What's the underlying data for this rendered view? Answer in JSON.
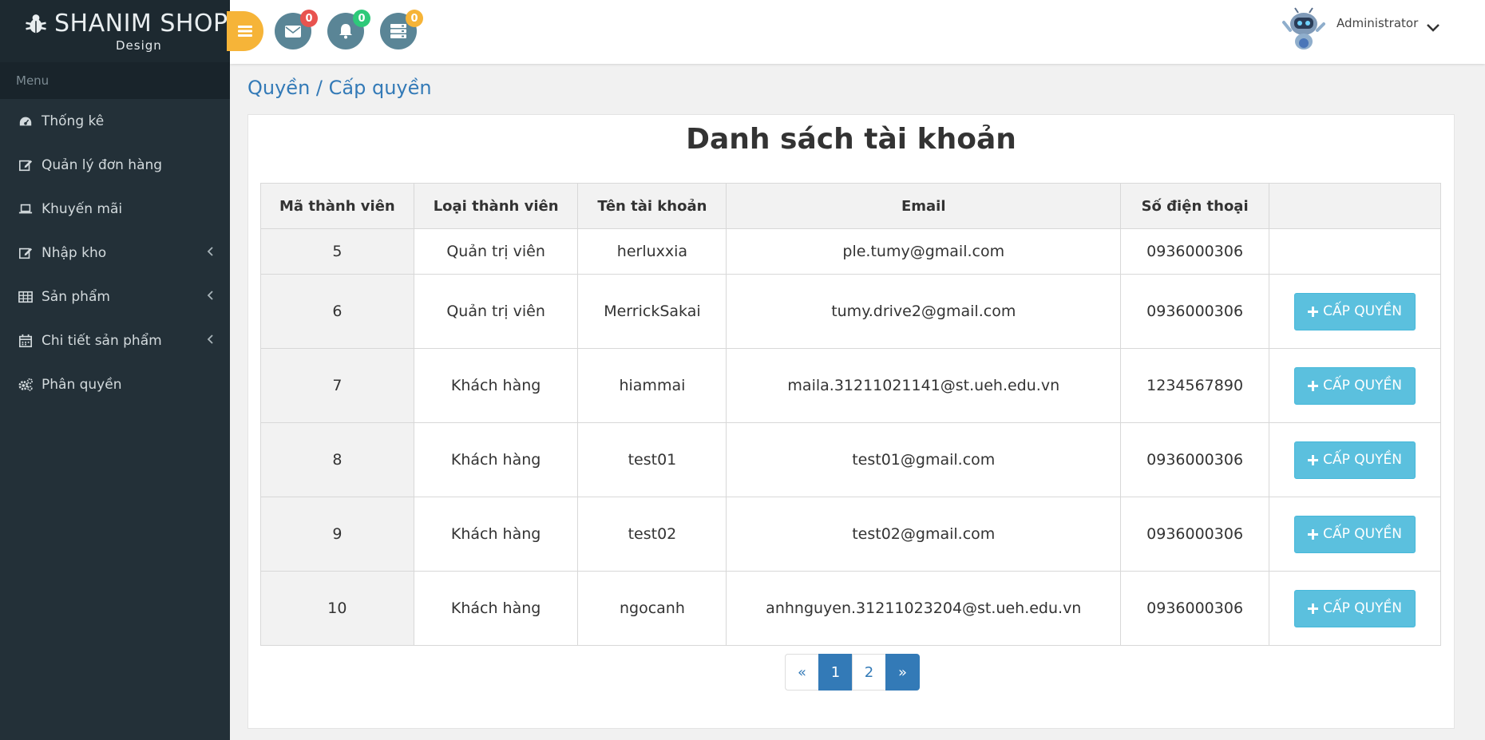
{
  "brand": {
    "title": "SHANIM SHOP",
    "subtitle": "Design"
  },
  "sidebar": {
    "menu_label": "Menu",
    "items": [
      {
        "label": "Thống kê",
        "icon": "dashboard-icon"
      },
      {
        "label": "Quản lý đơn hàng",
        "icon": "edit-icon"
      },
      {
        "label": "Khuyến mãi",
        "icon": "laptop-icon"
      },
      {
        "label": "Nhập kho",
        "icon": "edit-icon",
        "has_submenu": true
      },
      {
        "label": "Sản phẩm",
        "icon": "table-icon",
        "has_submenu": true
      },
      {
        "label": "Chi tiết sản phẩm",
        "icon": "calendar-icon",
        "has_submenu": true
      },
      {
        "label": "Phân quyền",
        "icon": "gears-icon"
      }
    ]
  },
  "header": {
    "mail_count": "0",
    "bell_count": "0",
    "tasks_count": "0",
    "user_name": "Administrator",
    "colors": {
      "mail_badge": "#e8534f",
      "bell_badge": "#2ec97a",
      "tasks_badge": "#f6b438",
      "toggle": "#f6b438"
    }
  },
  "breadcrumb": "Quyền / Cấp quyền",
  "panel": {
    "title": "Danh sách tài khoản"
  },
  "table": {
    "headers": [
      "Mã thành viên",
      "Loại thành viên",
      "Tên tài khoản",
      "Email",
      "Số điện thoại",
      ""
    ],
    "rows": [
      {
        "id": "5",
        "type": "Quản trị viên",
        "username": "herluxxia",
        "email": "ple.tumy@gmail.com",
        "phone": "0936000306",
        "action": ""
      },
      {
        "id": "6",
        "type": "Quản trị viên",
        "username": "MerrickSakai",
        "email": "tumy.drive2@gmail.com",
        "phone": "0936000306",
        "action": "CẤP QUYỀN"
      },
      {
        "id": "7",
        "type": "Khách hàng",
        "username": "hiammai",
        "email": "maila.31211021141@st.ueh.edu.vn",
        "phone": "1234567890",
        "action": "CẤP QUYỀN"
      },
      {
        "id": "8",
        "type": "Khách hàng",
        "username": "test01",
        "email": "test01@gmail.com",
        "phone": "0936000306",
        "action": "CẤP QUYỀN"
      },
      {
        "id": "9",
        "type": "Khách hàng",
        "username": "test02",
        "email": "test02@gmail.com",
        "phone": "0936000306",
        "action": "CẤP QUYỀN"
      },
      {
        "id": "10",
        "type": "Khách hàng",
        "username": "ngocanh",
        "email": "anhnguyen.31211023204@st.ueh.edu.vn",
        "phone": "0936000306",
        "action": "CẤP QUYỀN"
      }
    ]
  },
  "pagination": {
    "prev": "«",
    "pages": [
      "1",
      "2"
    ],
    "current": "1",
    "next": "»"
  }
}
